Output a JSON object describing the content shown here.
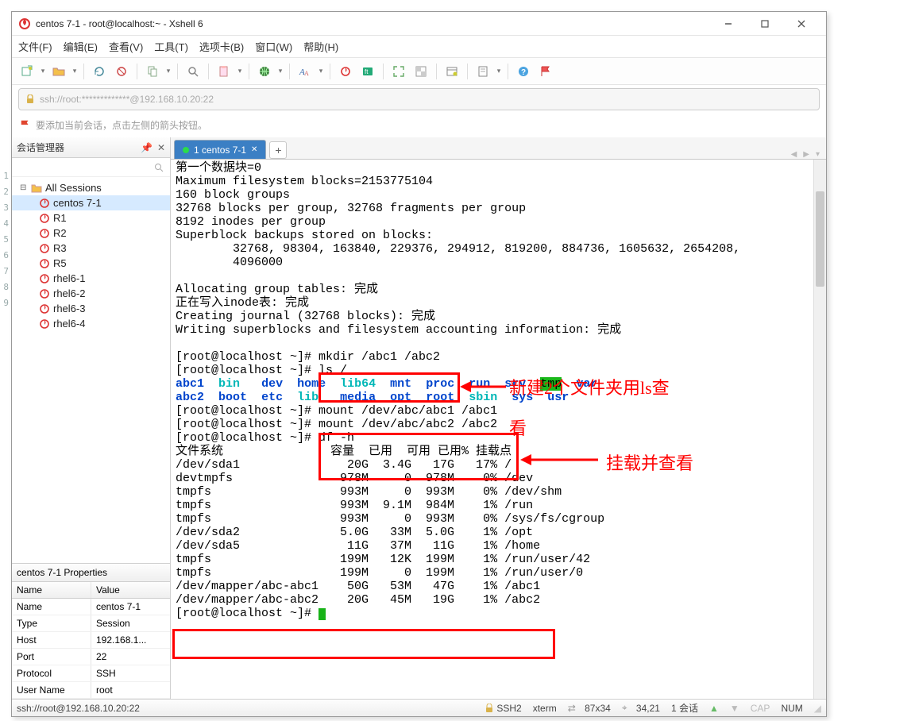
{
  "window": {
    "title": "centos 7-1 - root@localhost:~ - Xshell 6"
  },
  "menu": [
    "文件(F)",
    "编辑(E)",
    "查看(V)",
    "工具(T)",
    "选项卡(B)",
    "窗口(W)",
    "帮助(H)"
  ],
  "addressbar": "ssh://root:*************@192.168.10.20:22",
  "infobar": "要添加当前会话，点击左侧的箭头按钮。",
  "session_panel": {
    "title": "会话管理器",
    "root": "All Sessions",
    "items": [
      "centos 7-1",
      "R1",
      "R2",
      "R3",
      "R5",
      "rhel6-1",
      "rhel6-2",
      "rhel6-3",
      "rhel6-4"
    ],
    "selected_index": 0
  },
  "properties": {
    "title": "centos 7-1 Properties",
    "headers": [
      "Name",
      "Value"
    ],
    "rows": [
      [
        "Name",
        "centos 7-1"
      ],
      [
        "Type",
        "Session"
      ],
      [
        "Host",
        "192.168.1..."
      ],
      [
        "Port",
        "22"
      ],
      [
        "Protocol",
        "SSH"
      ],
      [
        "User Name",
        "root"
      ]
    ]
  },
  "tab": {
    "label": "1 centos 7-1",
    "add": "+"
  },
  "terminal": {
    "pre_lines": [
      "第一个数据块=0",
      "Maximum filesystem blocks=2153775104",
      "160 block groups",
      "32768 blocks per group, 32768 fragments per group",
      "8192 inodes per group",
      "Superblock backups stored on blocks:",
      "        32768, 98304, 163840, 229376, 294912, 819200, 884736, 1605632, 2654208,",
      "        4096000",
      "",
      "Allocating group tables: 完成",
      "正在写入inode表: 完成",
      "Creating journal (32768 blocks): 完成",
      "Writing superblocks and filesystem accounting information: 完成",
      ""
    ],
    "prompt": "[root@localhost ~]# ",
    "cmd_mkdir": "mkdir /abc1 /abc2",
    "cmd_ls": "ls /",
    "ls_row1": {
      "abc1": "abc1",
      "bin": "bin",
      "dev": "dev",
      "home": "home",
      "lib64": "lib64",
      "mnt": "mnt",
      "proc": "proc",
      "run": "run",
      "srv": "srv",
      "tmp": "tmp",
      "var": "var"
    },
    "ls_row2": {
      "abc2": "abc2",
      "boot": "boot",
      "etc": "etc",
      "lib": "lib",
      "media": "media",
      "opt": "opt",
      "root": "root",
      "sbin": "sbin",
      "sys": "sys",
      "usr": "usr"
    },
    "cmd_mount1": "mount /dev/abc/abc1 /abc1",
    "cmd_mount2": "mount /dev/abc/abc2 /abc2",
    "cmd_df": "df -h",
    "df_header": "文件系统               容量  已用  可用 已用% 挂载点",
    "df_rows": [
      "/dev/sda1               20G  3.4G   17G   17% /",
      "devtmpfs               978M     0  978M    0% /dev",
      "tmpfs                  993M     0  993M    0% /dev/shm",
      "tmpfs                  993M  9.1M  984M    1% /run",
      "tmpfs                  993M     0  993M    0% /sys/fs/cgroup",
      "/dev/sda2              5.0G   33M  5.0G    1% /opt",
      "/dev/sda5               11G   37M   11G    1% /home",
      "tmpfs                  199M   12K  199M    1% /run/user/42",
      "tmpfs                  199M     0  199M    1% /run/user/0",
      "/dev/mapper/abc-abc1    50G   53M   47G    1% /abc1",
      "/dev/mapper/abc-abc2    20G   45M   19G    1% /abc2"
    ]
  },
  "annotations": {
    "note1": "新建2个文件夹用ls查",
    "note1b": "看",
    "note2": "挂载并查看"
  },
  "statusbar": {
    "left": "ssh://root@192.168.10.20:22",
    "ssh": "SSH2",
    "term": "xterm",
    "size": "87x34",
    "cursor": "34,21",
    "sess": "1 会话",
    "cap": "CAP",
    "num": "NUM"
  },
  "gutter": [
    "1",
    "2",
    "3",
    "4",
    "5",
    "6",
    "7",
    "8",
    "9"
  ]
}
